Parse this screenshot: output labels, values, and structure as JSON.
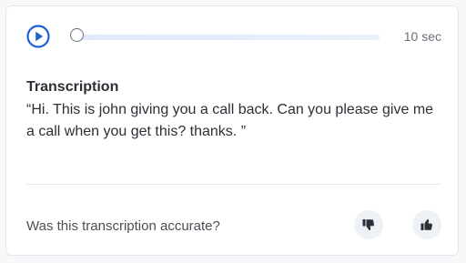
{
  "player": {
    "duration": "10 sec",
    "progress": 0,
    "play_icon": "play-circle-icon"
  },
  "transcription": {
    "heading": "Transcription",
    "text": "“Hi. This is john giving you a call back. Can you please give me a call when you get this? thanks. ”"
  },
  "feedback": {
    "question": "Was this transcription accurate?",
    "thumbs_down_icon": "thumbs-down-icon",
    "thumbs_up_icon": "thumbs-up-icon"
  },
  "colors": {
    "accent": "#1f5fd6",
    "track": "#e4ecfa",
    "icon": "#2b2f36",
    "button_bg": "#eef2f7"
  }
}
